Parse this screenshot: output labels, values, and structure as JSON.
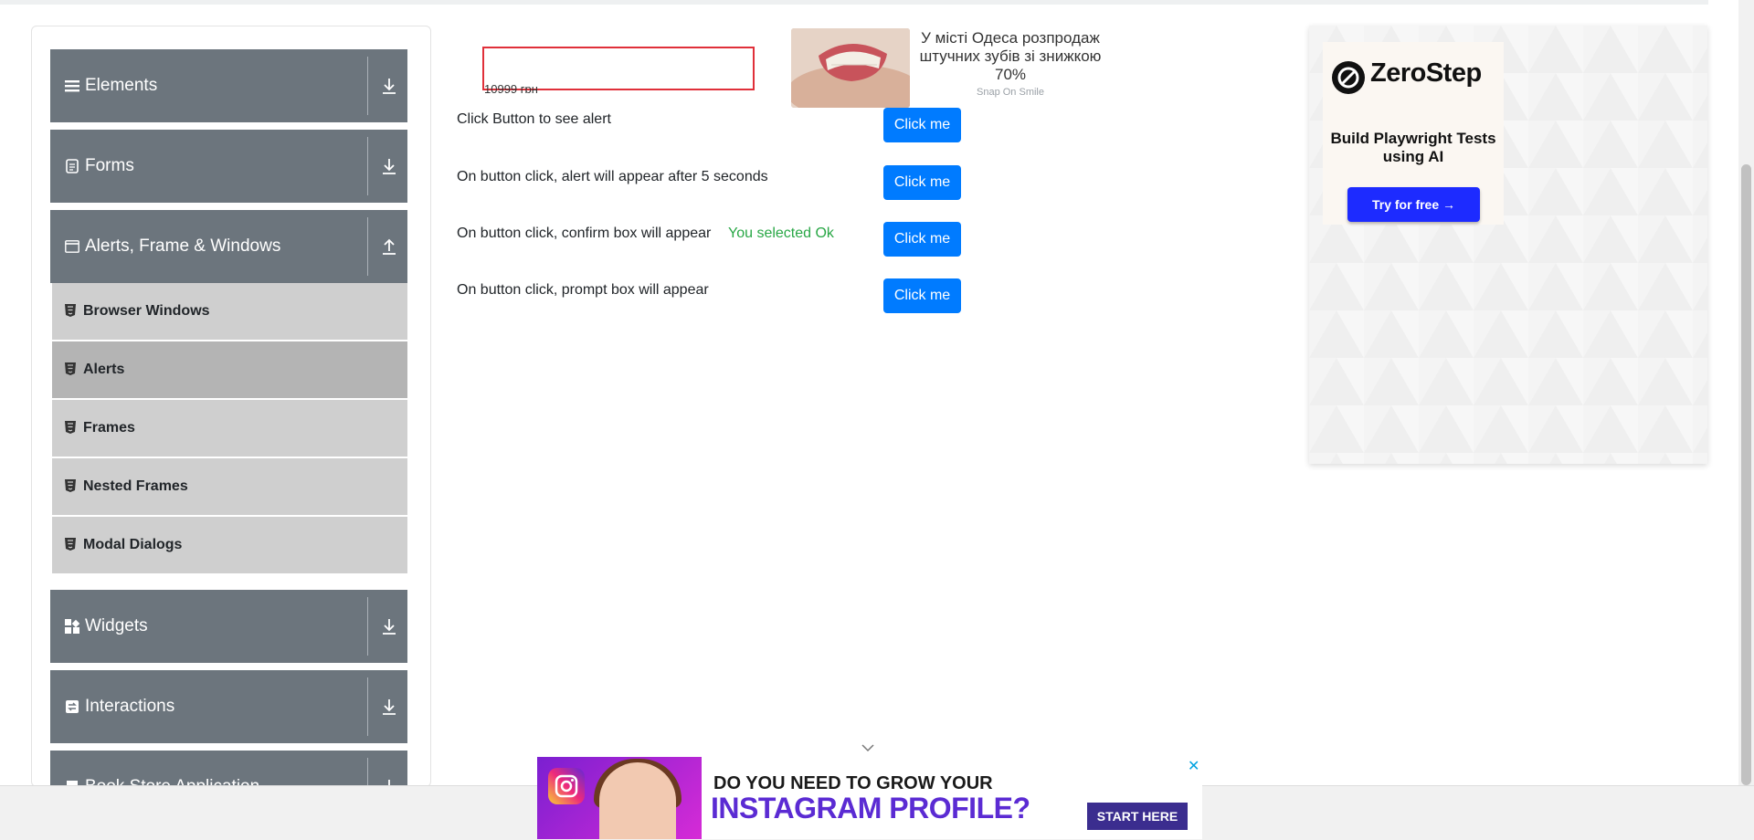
{
  "sidebar": {
    "groups": [
      {
        "label": "Elements",
        "icon": "list-icon",
        "expanded": false
      },
      {
        "label": "Forms",
        "icon": "form-icon",
        "expanded": false
      },
      {
        "label": "Alerts, Frame & Windows",
        "icon": "window-icon",
        "expanded": true
      },
      {
        "label": "Widgets",
        "icon": "widgets-icon",
        "expanded": false
      },
      {
        "label": "Interactions",
        "icon": "interactions-icon",
        "expanded": false
      },
      {
        "label": "Book Store Application",
        "icon": "book-icon",
        "expanded": false
      }
    ],
    "items": [
      {
        "label": "Browser Windows",
        "active": false
      },
      {
        "label": "Alerts",
        "active": true
      },
      {
        "label": "Frames",
        "active": false
      },
      {
        "label": "Nested Frames",
        "active": false
      },
      {
        "label": "Modal Dialogs",
        "active": false
      }
    ]
  },
  "top_ad": {
    "price": "10999 грн",
    "title": "У місті Одеса розпродаж штучних зубів зі знижкою 70%",
    "source": "Snap On Smile"
  },
  "alerts": {
    "rows": [
      {
        "text": "Click Button to see alert",
        "button": "Click me",
        "result": ""
      },
      {
        "text": "On button click, alert will appear after 5 seconds",
        "button": "Click me",
        "result": ""
      },
      {
        "text": "On button click, confirm box will appear",
        "button": "Click me",
        "result": "You selected Ok"
      },
      {
        "text": "On button click, prompt box will appear",
        "button": "Click me",
        "result": ""
      }
    ]
  },
  "right_ad": {
    "brand": "ZeroStep",
    "tagline": "Build Playwright Tests using AI",
    "cta": "Try for free →"
  },
  "bottom_ad": {
    "line1": "DO YOU NEED TO GROW YOUR",
    "line2": "INSTAGRAM PROFILE?",
    "cta": "START HERE",
    "close": "✕"
  },
  "colors": {
    "group_bg": "#6c757d",
    "item_bg": "#cfcfcf",
    "item_active_bg": "#b4b4b4",
    "primary_button": "#007bff",
    "success_text": "#28a745"
  }
}
